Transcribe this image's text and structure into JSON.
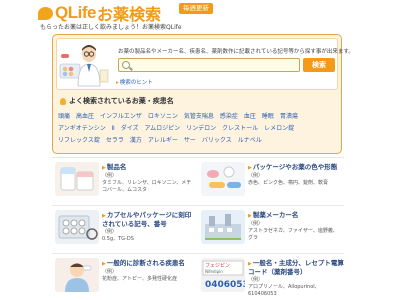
{
  "header": {
    "logo_text": "QLife",
    "logo_suffix": "お薬検索",
    "update_badge": "毎週更新",
    "tagline": "もらったお薬は正しく飲みましょう！お薬検索QLife"
  },
  "search": {
    "description": "お薬の製品名やメーカー名、疾患名、薬剤数作に記載されている記号等から探す事が出来ます。",
    "input_value": "",
    "button_label": "検索",
    "hint_link": "検索のヒント"
  },
  "popular": {
    "title": "よく検索されているお薬・疾患名",
    "tags": [
      "頭痛",
      "高血圧",
      "インフルエンザ",
      "ロキソニン",
      "気管支喘息",
      "感染症",
      "血圧",
      "睡眠",
      "胃潰瘍",
      "アンギオテンシン",
      "Ⅱ",
      "ダイズ",
      "アムロジピン",
      "リンデロン",
      "クレストール",
      "レメロン錠",
      "リフレックス錠",
      "セララ",
      "漢方",
      "アレルギー",
      "サー",
      "バリックス",
      "ルナベル"
    ]
  },
  "cards": [
    {
      "title": "製品名",
      "ex_label": "（例）",
      "ex_text": "タミフル、リレンザ、ロキソニン、メチコバール、ムコスタ"
    },
    {
      "title": "パッケージやお薬の色や形態",
      "ex_label": "（例）",
      "ex_text": "赤色、ピンク色、楕円、錠剤、軟膏"
    },
    {
      "title": "カプセルやパッケージに刻印されている記号、番号",
      "ex_label": "（例）",
      "ex_text": "0.5g、TG-DS"
    },
    {
      "title": "製薬メーカー名",
      "ex_label": "（例）",
      "ex_text": "アストラゼネカ、ファイザー、塩野義、グラ"
    },
    {
      "title": "一般的に診断される疾患名",
      "ex_label": "（例）",
      "ex_text": "花粉症、アトピー、多発性硬化症"
    },
    {
      "title": "一般名・主成分、レセプト電算コード（薬剤番号）",
      "ex_label": "（例）",
      "ex_text": "アロプリノール、Allopurinol、610406053"
    }
  ],
  "thumb_labels": {
    "pill_sheet": "フェジピン",
    "code": "0406053"
  },
  "colors": {
    "brand_orange": "#f29b16",
    "link_blue": "#2b5eb5",
    "panel_bg": "#fdf3de"
  }
}
